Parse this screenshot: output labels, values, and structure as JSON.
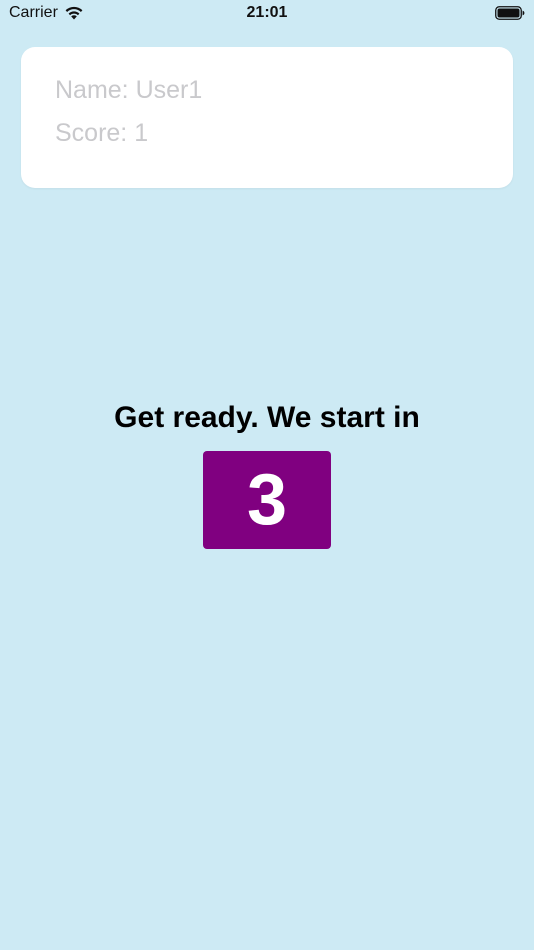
{
  "status_bar": {
    "carrier": "Carrier",
    "time": "21:01",
    "wifi_icon": "wifi-icon",
    "battery_icon": "battery-icon"
  },
  "player": {
    "name_text": "Name: User1",
    "score_text": "Score: 1"
  },
  "countdown": {
    "title": "Get ready. We start in",
    "value": "3"
  },
  "colors": {
    "background": "#cdeaf4",
    "card": "#ffffff",
    "countdown_box": "#800080",
    "placeholder_text": "#c9c9cc"
  }
}
